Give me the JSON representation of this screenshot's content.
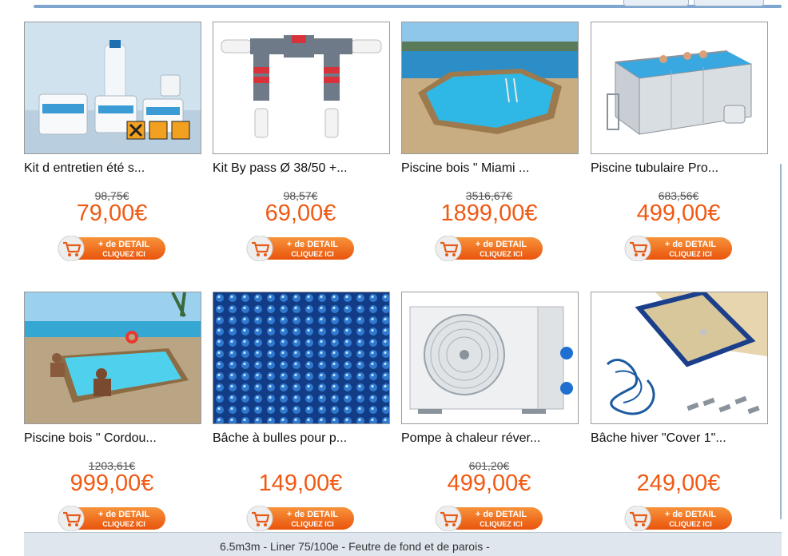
{
  "products": [
    {
      "title": "Kit d entretien été s...",
      "old_price": "98,75€",
      "price": "79,00€"
    },
    {
      "title": "Kit By pass Ø 38/50 +...",
      "old_price": "98,57€",
      "price": "69,00€"
    },
    {
      "title": "Piscine bois \" Miami ...",
      "old_price": "3516,67€",
      "price": "1899,00€"
    },
    {
      "title": "Piscine tubulaire Pro...",
      "old_price": "683,56€",
      "price": "499,00€"
    },
    {
      "title": "Piscine bois \" Cordou...",
      "old_price": "1203,61€",
      "price": "999,00€"
    },
    {
      "title": "Bâche à bulles pour p...",
      "old_price": "",
      "price": "149,00€"
    },
    {
      "title": "Pompe à chaleur réver...",
      "old_price": "601,20€",
      "price": "499,00€"
    },
    {
      "title": "Bâche hiver \"Cover 1\"...",
      "old_price": "",
      "price": "249,00€"
    }
  ],
  "button": {
    "line1": "+ de DETAIL",
    "line2": "CLIQUEZ ICI"
  },
  "footer_text": "6.5m3m - Liner 75/100e - Feutre de fond et de parois -",
  "colors": {
    "price": "#f05a14",
    "button": "#f26a1b",
    "frame": "#7ea6cf"
  }
}
